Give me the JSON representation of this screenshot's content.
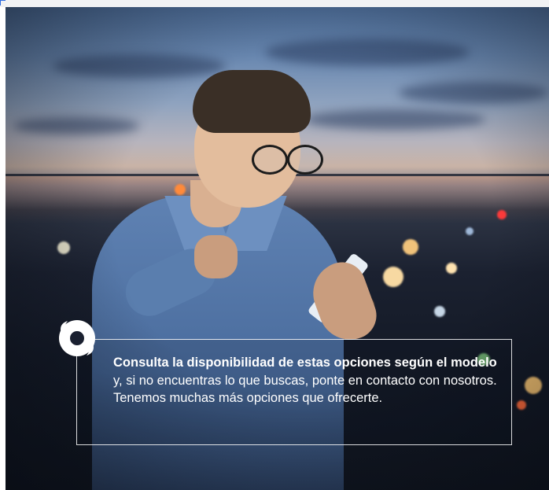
{
  "callout": {
    "bold_text": "Consulta la disponibilidad de estas opciones según el modelo",
    "body_text": " y, si no encuentras lo que buscas, ponte en contacto con nosotros. Tenemos muchas más opciones que ofrecerte."
  },
  "icons": {
    "logo": "circular-swirl-logo-icon"
  },
  "colors": {
    "callout_text": "#ffffff",
    "callout_border": "#ffffff",
    "sky_top": "#4d6d98",
    "night_bottom": "#10151f"
  }
}
